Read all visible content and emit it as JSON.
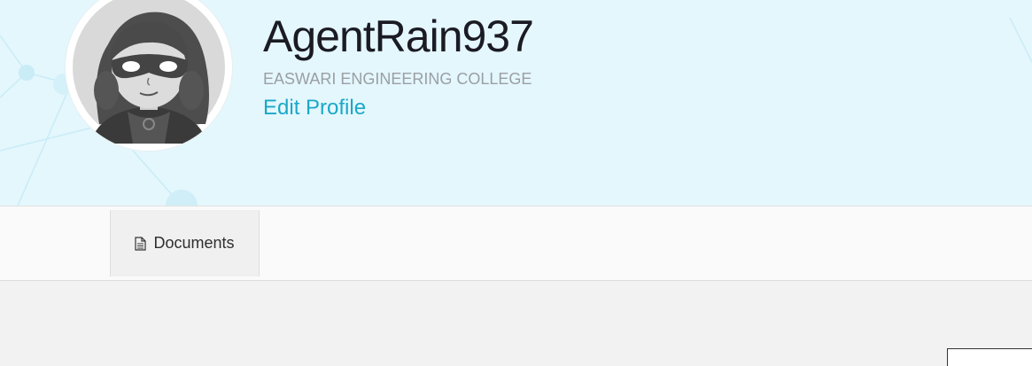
{
  "profile": {
    "username": "AgentRain937",
    "college": "EASWARI ENGINEERING COLLEGE",
    "edit_label": "Edit Profile",
    "avatar_icon": "superhero-avatar"
  },
  "tabs": [
    {
      "label": "Documents",
      "icon": "document-icon",
      "active": true
    }
  ],
  "colors": {
    "banner": "#e4f7fd",
    "link": "#1aa8c7",
    "title": "#1b1b24",
    "subtitle": "#9a9fa3"
  }
}
